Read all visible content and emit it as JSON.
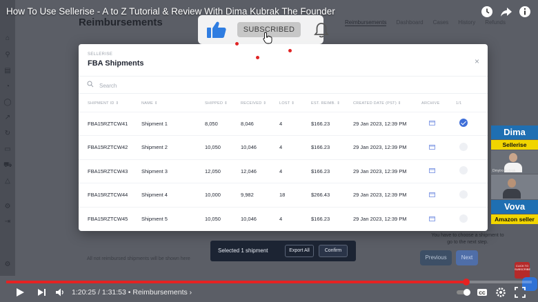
{
  "video": {
    "title": "How To Use Sellerise - A to Z Tutorial & Review With Dima Kubrak The Founder",
    "current_time": "1:20:25",
    "duration": "1:31:53",
    "chapter": "Reimbursements",
    "time_separator": " / ",
    "chapter_separator": " • ",
    "chapter_suffix": " ›",
    "progress": 0.875,
    "buffered": 0.88
  },
  "subscribe": {
    "label": "SUBSCRIBED"
  },
  "app": {
    "page_title": "Reimbursements",
    "tabs": [
      "Reimbursements",
      "Dashboard",
      "Cases",
      "History",
      "Refunds"
    ],
    "active_tab": 0,
    "hint": "You have to choose a shipment to go to the next step.",
    "footnote": "All not reimbursed shipments will be shown here",
    "previous_label": "Previous",
    "next_label": "Next"
  },
  "modal": {
    "kicker": "SELLERISE",
    "title": "FBA Shipments",
    "search_placeholder": "Search",
    "columns": [
      "SHIPMENT ID ⇕",
      "NAME ⇕",
      "SHIPPED ⇕",
      "RECEIVED ⇕",
      "LOST ⇕",
      "EST. REIMB. ⇕",
      "CREATED DATE (PST) ⇕",
      "ARCHIVE",
      "1/1"
    ],
    "rows": [
      {
        "id": "FBA15RZTCW41",
        "name": "Shipment 1",
        "shipped": "8,050",
        "received": "8,046",
        "lost": "4",
        "reimb": "$166.23",
        "date": "29 Jan 2023, 12:39 PM",
        "selected": true
      },
      {
        "id": "FBA15RZTCW42",
        "name": "Shipment 2",
        "shipped": "10,050",
        "received": "10,046",
        "lost": "4",
        "reimb": "$166.23",
        "date": "29 Jan 2023, 12:39 PM",
        "selected": false
      },
      {
        "id": "FBA15RZTCW43",
        "name": "Shipment 3",
        "shipped": "12,050",
        "received": "12,046",
        "lost": "4",
        "reimb": "$166.23",
        "date": "29 Jan 2023, 12:39 PM",
        "selected": false
      },
      {
        "id": "FBA15RZTCW44",
        "name": "Shipment 4",
        "shipped": "10,000",
        "received": "9,982",
        "lost": "18",
        "reimb": "$266.43",
        "date": "29 Jan 2023, 12:39 PM",
        "selected": false
      },
      {
        "id": "FBA15RZTCW45",
        "name": "Shipment 5",
        "shipped": "10,050",
        "received": "10,046",
        "lost": "4",
        "reimb": "$166.23",
        "date": "29 Jan 2023, 12:39 PM",
        "selected": false
      }
    ]
  },
  "selection_bar": {
    "text": "Selected 1 shipment",
    "export_label": "Export All",
    "confirm_label": "Confirm"
  },
  "promo": {
    "host1_name": "Dima",
    "host1_company": "Sellerise",
    "host1_cam_label": "Dmytro Kubrak",
    "host2_name": "Vova",
    "host2_role": "Amazon seller"
  },
  "click_badge": "CLICK TO SUBSCRIBE",
  "colors": {
    "accent": "#3f6fd8",
    "youtube_red": "#e52222",
    "promo_blue": "#1f6fb2",
    "promo_yellow": "#f1d500"
  }
}
